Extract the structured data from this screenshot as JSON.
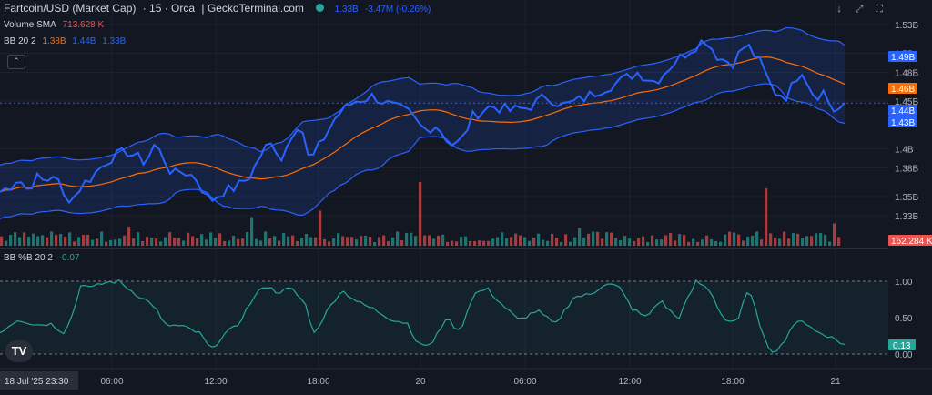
{
  "header": {
    "pair": "Fartcoin/USD (Market Cap)",
    "interval": "· 15 · Orca",
    "source": "| GeckoTerminal.com",
    "value": "1.33B",
    "change": "-3.47M (-0.26%)"
  },
  "indicators": {
    "volume_label": "Volume SMA",
    "volume_value": "713.628 K",
    "bb_label": "BB 20 2",
    "bb_values": [
      "1.38B",
      "1.44B",
      "1.33B"
    ],
    "pctb_label": "BB %B 20 2",
    "pctb_value": "-0.07"
  },
  "toolbar": {
    "down_icon": "↓",
    "expand_icon": "⤢",
    "fullscreen_icon": "⛶",
    "collapse_icon": "⌃"
  },
  "logo_text": "TV",
  "colors": {
    "price": "#2962ff",
    "band": "#2962ff",
    "basis": "#ff6d00",
    "vol_up": "#26a69a",
    "vol_down": "#ef5350",
    "pctb": "#26a69a"
  },
  "chart_data": {
    "type": "line",
    "price_axis": {
      "ticks": [
        "1.53B",
        "1.5B",
        "1.48B",
        "1.45B",
        "1.4B",
        "1.38B",
        "1.35B",
        "1.33B"
      ],
      "labels": [
        {
          "text": "1.49B",
          "color": "#2962ff"
        },
        {
          "text": "1.46B",
          "color": "#ff6d00"
        },
        {
          "text": "1.44B",
          "color": "#2962ff"
        },
        {
          "text": "1.43B",
          "color": "#2962ff"
        },
        {
          "text": "162.284 K",
          "color": "#ef5350"
        }
      ]
    },
    "pctb_axis": {
      "ticks": [
        "1.00",
        "0.50",
        "0.00"
      ],
      "label": {
        "text": "0.13",
        "color": "#26a69a"
      }
    },
    "time_axis": {
      "first_label": "18 Jul '25  23:30",
      "ticks": [
        "06:00",
        "12:00",
        "18:00",
        "20",
        "06:00",
        "12:00",
        "18:00",
        "21"
      ]
    },
    "price_anchors": [
      [
        0,
        1.355
      ],
      [
        10,
        1.36
      ],
      [
        20,
        1.37
      ],
      [
        30,
        1.357
      ],
      [
        40,
        1.37
      ],
      [
        50,
        1.365
      ],
      [
        60,
        1.375
      ],
      [
        70,
        1.35
      ],
      [
        80,
        1.348
      ],
      [
        90,
        1.362
      ],
      [
        100,
        1.37
      ],
      [
        110,
        1.38
      ],
      [
        120,
        1.39
      ],
      [
        140,
        1.397
      ],
      [
        160,
        1.386
      ],
      [
        170,
        1.405
      ],
      [
        180,
        1.39
      ],
      [
        190,
        1.372
      ],
      [
        200,
        1.377
      ],
      [
        215,
        1.37
      ],
      [
        230,
        1.345
      ],
      [
        245,
        1.355
      ],
      [
        260,
        1.36
      ],
      [
        275,
        1.372
      ],
      [
        290,
        1.4
      ],
      [
        300,
        1.405
      ],
      [
        310,
        1.39
      ],
      [
        320,
        1.415
      ],
      [
        330,
        1.43
      ],
      [
        340,
        1.385
      ],
      [
        355,
        1.41
      ],
      [
        370,
        1.435
      ],
      [
        390,
        1.45
      ],
      [
        410,
        1.455
      ],
      [
        430,
        1.445
      ],
      [
        450,
        1.437
      ],
      [
        465,
        1.42
      ],
      [
        480,
        1.425
      ],
      [
        495,
        1.405
      ],
      [
        505,
        1.405
      ],
      [
        520,
        1.435
      ],
      [
        540,
        1.445
      ],
      [
        560,
        1.44
      ],
      [
        580,
        1.443
      ],
      [
        600,
        1.455
      ],
      [
        620,
        1.445
      ],
      [
        640,
        1.452
      ],
      [
        660,
        1.462
      ],
      [
        680,
        1.47
      ],
      [
        700,
        1.48
      ],
      [
        720,
        1.47
      ],
      [
        740,
        1.49
      ],
      [
        760,
        1.505
      ],
      [
        775,
        1.515
      ],
      [
        790,
        1.495
      ],
      [
        805,
        1.49
      ],
      [
        820,
        1.51
      ],
      [
        835,
        1.49
      ],
      [
        850,
        1.46
      ],
      [
        865,
        1.455
      ],
      [
        880,
        1.485
      ],
      [
        895,
        1.455
      ],
      [
        905,
        1.46
      ],
      [
        915,
        1.44
      ],
      [
        928,
        1.443
      ]
    ],
    "pctb_anchors": [
      [
        0,
        0.3
      ],
      [
        20,
        0.48
      ],
      [
        40,
        0.4
      ],
      [
        55,
        0.42
      ],
      [
        70,
        0.3
      ],
      [
        80,
        0.55
      ],
      [
        90,
        1.0
      ],
      [
        100,
        0.9
      ],
      [
        115,
        0.98
      ],
      [
        130,
        1.0
      ],
      [
        150,
        0.82
      ],
      [
        170,
        0.66
      ],
      [
        180,
        0.4
      ],
      [
        200,
        0.38
      ],
      [
        220,
        0.28
      ],
      [
        232,
        0.05
      ],
      [
        245,
        0.26
      ],
      [
        260,
        0.38
      ],
      [
        275,
        0.7
      ],
      [
        290,
        0.95
      ],
      [
        305,
        0.85
      ],
      [
        320,
        0.9
      ],
      [
        335,
        0.7
      ],
      [
        345,
        0.28
      ],
      [
        360,
        0.6
      ],
      [
        375,
        0.88
      ],
      [
        395,
        0.7
      ],
      [
        410,
        0.62
      ],
      [
        430,
        0.48
      ],
      [
        448,
        0.42
      ],
      [
        460,
        0.12
      ],
      [
        475,
        0.14
      ],
      [
        490,
        0.5
      ],
      [
        505,
        0.3
      ],
      [
        520,
        0.82
      ],
      [
        535,
        0.9
      ],
      [
        550,
        0.7
      ],
      [
        570,
        0.46
      ],
      [
        590,
        0.6
      ],
      [
        610,
        0.4
      ],
      [
        630,
        0.78
      ],
      [
        650,
        0.82
      ],
      [
        665,
        0.98
      ],
      [
        680,
        0.92
      ],
      [
        695,
        0.62
      ],
      [
        710,
        0.5
      ],
      [
        725,
        0.74
      ],
      [
        745,
        0.48
      ],
      [
        765,
        1.0
      ],
      [
        780,
        0.88
      ],
      [
        795,
        0.48
      ],
      [
        810,
        0.42
      ],
      [
        822,
        0.92
      ],
      [
        835,
        0.4
      ],
      [
        848,
        0.0
      ],
      [
        862,
        0.18
      ],
      [
        878,
        0.5
      ],
      [
        895,
        0.32
      ],
      [
        910,
        0.25
      ],
      [
        928,
        0.13
      ]
    ],
    "volume_spikes": [
      [
        140,
        0.3
      ],
      [
        275,
        0.45
      ],
      [
        352,
        0.55
      ],
      [
        458,
        1.0
      ],
      [
        635,
        0.28
      ],
      [
        842,
        0.9
      ],
      [
        915,
        0.35
      ]
    ]
  }
}
